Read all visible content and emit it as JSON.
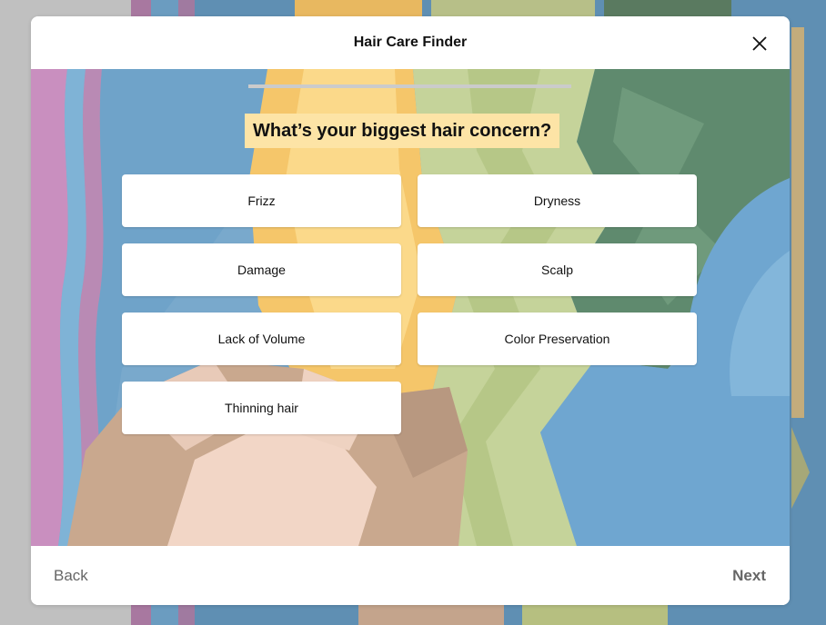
{
  "modal": {
    "title": "Hair Care Finder",
    "close_icon": "close-icon"
  },
  "quiz": {
    "progress": 0,
    "question": "What’s your biggest hair concern?",
    "options": [
      {
        "label": "Frizz"
      },
      {
        "label": "Dryness"
      },
      {
        "label": "Damage"
      },
      {
        "label": "Scalp"
      },
      {
        "label": "Lack of Volume"
      },
      {
        "label": "Color Preservation"
      },
      {
        "label": "Thinning hair"
      }
    ]
  },
  "footer": {
    "back_label": "Back",
    "next_label": "Next"
  },
  "colors": {
    "question_highlight": "#fde4a6",
    "progress_track": "#cbcbcb",
    "backdrop": "#c0c0c0"
  }
}
